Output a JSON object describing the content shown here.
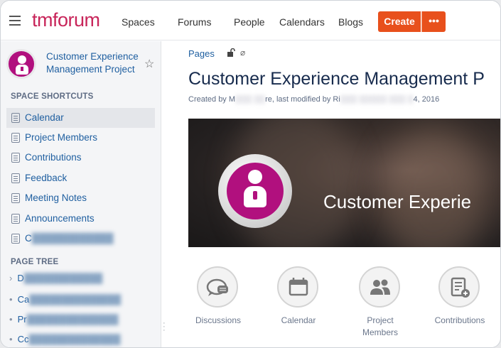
{
  "header": {
    "logo": "tmforum",
    "nav": [
      "Spaces",
      "Forums",
      "People",
      "Calendars",
      "Blogs"
    ],
    "create_label": "Create",
    "more_label": "•••"
  },
  "sidebar": {
    "space_title": "Customer Experience Management Project",
    "shortcuts_heading": "SPACE SHORTCUTS",
    "shortcuts": [
      "Calendar",
      "Project Members",
      "Contributions",
      "Feedback",
      "Meeting Notes",
      "Announcements",
      "C"
    ],
    "tree_heading": "PAGE TREE",
    "tree": [
      {
        "bullet": "›",
        "label": "D"
      },
      {
        "bullet": "•",
        "label": "Ca"
      },
      {
        "bullet": "•",
        "label": "Pr"
      },
      {
        "bullet": "•",
        "label": "Cc"
      }
    ]
  },
  "main": {
    "breadcrumb": "Pages",
    "title": "Customer Experience Management P",
    "byline_start": "Created by M",
    "byline_mid": "re, last modified by Ri",
    "byline_end": "4, 2016",
    "banner_text": "Customer Experie",
    "shortcut_tiles": [
      {
        "label": "Discussions",
        "icon": "discussions-icon"
      },
      {
        "label": "Calendar",
        "icon": "calendar-icon"
      },
      {
        "label": "Project Members",
        "icon": "members-icon"
      },
      {
        "label": "Contributions",
        "icon": "contributions-icon"
      }
    ]
  },
  "colors": {
    "accent": "#e8501c",
    "brand": "#c8255a",
    "space": "#b1107e",
    "link": "#1f5fa0"
  }
}
